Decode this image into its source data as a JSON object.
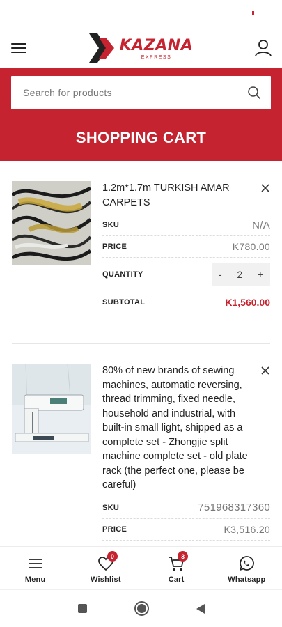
{
  "brand": {
    "name": "KAZANA",
    "sub": "EXPRESS",
    "color": "#c5232f"
  },
  "search": {
    "placeholder": "Search for products"
  },
  "page": {
    "title": "SHOPPING CART"
  },
  "cart": {
    "labels": {
      "sku": "SKU",
      "price": "PRICE",
      "quantity": "QUANTITY",
      "subtotal": "SUBTOTAL"
    },
    "items": [
      {
        "title": "1.2m*1.7m TURKISH AMAR CARPETS",
        "sku": "N/A",
        "price": "K780.00",
        "quantity": "2",
        "subtotal": "K1,560.00"
      },
      {
        "title": "80% of new brands of sewing machines, automatic reversing, thread trimming, fixed needle, household and industrial, with built-in small light, shipped as a complete set - Zhongjie split machine complete set - old plate rack (the perfect one, please be careful)",
        "sku": "751968317360",
        "price": "K3,516.20"
      }
    ],
    "stepper": {
      "minus": "-",
      "plus": "+"
    }
  },
  "bottom_nav": [
    {
      "label": "Menu",
      "icon": "menu-icon"
    },
    {
      "label": "Wishlist",
      "icon": "heart-icon",
      "badge": "0"
    },
    {
      "label": "Cart",
      "icon": "cart-icon",
      "badge": "3"
    },
    {
      "label": "Whatsapp",
      "icon": "whatsapp-icon"
    }
  ]
}
